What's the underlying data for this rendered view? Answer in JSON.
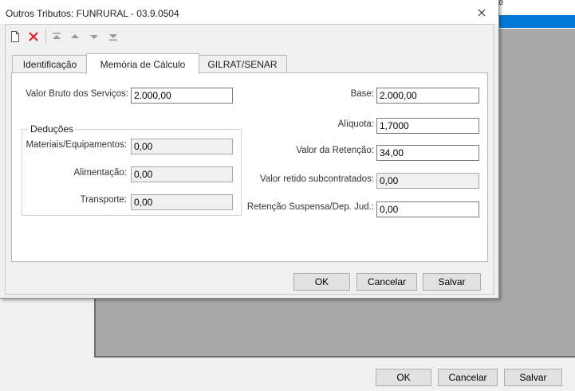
{
  "background_window": {
    "list_fragment_text": "e",
    "buttons": {
      "ok": "OK",
      "cancel": "Cancelar",
      "save": "Salvar"
    }
  },
  "dialog": {
    "title": "Outros Tributos: FUNRURAL - 03.9.0504",
    "close_icon": "close-x-icon",
    "toolbar": {
      "icons": [
        "new-document-icon",
        "delete-x-icon",
        "move-first-icon",
        "move-up-icon",
        "move-down-icon",
        "move-last-icon"
      ],
      "delete_color": "#e0242a"
    },
    "tabs": [
      {
        "label": "Identificação",
        "active": false
      },
      {
        "label": "Memória de Cálculo",
        "active": true
      },
      {
        "label": "GILRAT/SENAR",
        "active": false
      }
    ],
    "left": {
      "valor_bruto_label": "Valor Bruto dos Serviços:",
      "valor_bruto_value": "2.000,00",
      "deducoes_title": "Deduções",
      "materiais_label": "Materiais/Equipamentos:",
      "materiais_value": "0,00",
      "alimentacao_label": "Alimentação:",
      "alimentacao_value": "0,00",
      "transporte_label": "Transporte:",
      "transporte_value": "0,00"
    },
    "right": {
      "base_label": "Base:",
      "base_value": "2.000,00",
      "aliquota_label": "Alíquota:",
      "aliquota_value": "1,7000",
      "valor_retencao_label": "Valor da Retenção:",
      "valor_retencao_value": "34,00",
      "valor_retido_label": "Valor retido subcontratados:",
      "valor_retido_value": "0,00",
      "retencao_suspensa_label": "Retenção Suspensa/Dep. Jud.:",
      "retencao_suspensa_value": "0,00"
    },
    "buttons": {
      "ok": "OK",
      "cancel": "Cancelar",
      "save": "Salvar"
    }
  }
}
